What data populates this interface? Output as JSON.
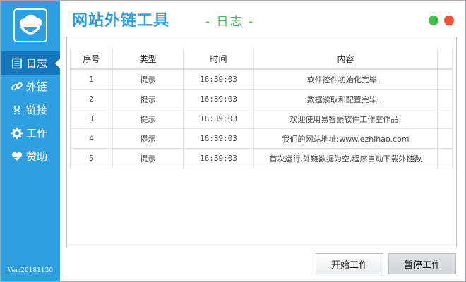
{
  "app": {
    "title": "网站外链工具",
    "subtitle": "- 日志 -",
    "version": "Ver:20181130"
  },
  "sidebar": {
    "items": [
      {
        "label": "日志",
        "icon": "log-icon",
        "active": true
      },
      {
        "label": "外链",
        "icon": "link-icon",
        "active": false
      },
      {
        "label": "链接",
        "icon": "chain-icon",
        "active": false
      },
      {
        "label": "工作",
        "icon": "gear-icon",
        "active": false
      },
      {
        "label": "赞助",
        "icon": "heart-hand-icon",
        "active": false
      }
    ]
  },
  "table": {
    "headers": [
      "序号",
      "类型",
      "时间",
      "内容"
    ],
    "rows": [
      [
        "1",
        "提示",
        "16:39:03",
        "软件控件初始化完毕..."
      ],
      [
        "2",
        "提示",
        "16:39:03",
        "数据读取和配置完毕..."
      ],
      [
        "3",
        "提示",
        "16:39:03",
        "欢迎使用易智豪软件工作室作品!"
      ],
      [
        "4",
        "提示",
        "16:39:03",
        "我们的网站地址:www.ezhihao.com"
      ],
      [
        "5",
        "提示",
        "16:39:03",
        "首次运行,外链数据为空,程序自动下载外链数"
      ]
    ]
  },
  "buttons": {
    "start": "开始工作",
    "pause": "暂停工作"
  },
  "colors": {
    "sidebar": "#2f9fe2",
    "sidebar_active": "#1576bd",
    "title": "#2f9fe2",
    "subtitle": "#3bbd5d",
    "dot_green": "#3ec14c",
    "dot_red": "#ee5337"
  }
}
